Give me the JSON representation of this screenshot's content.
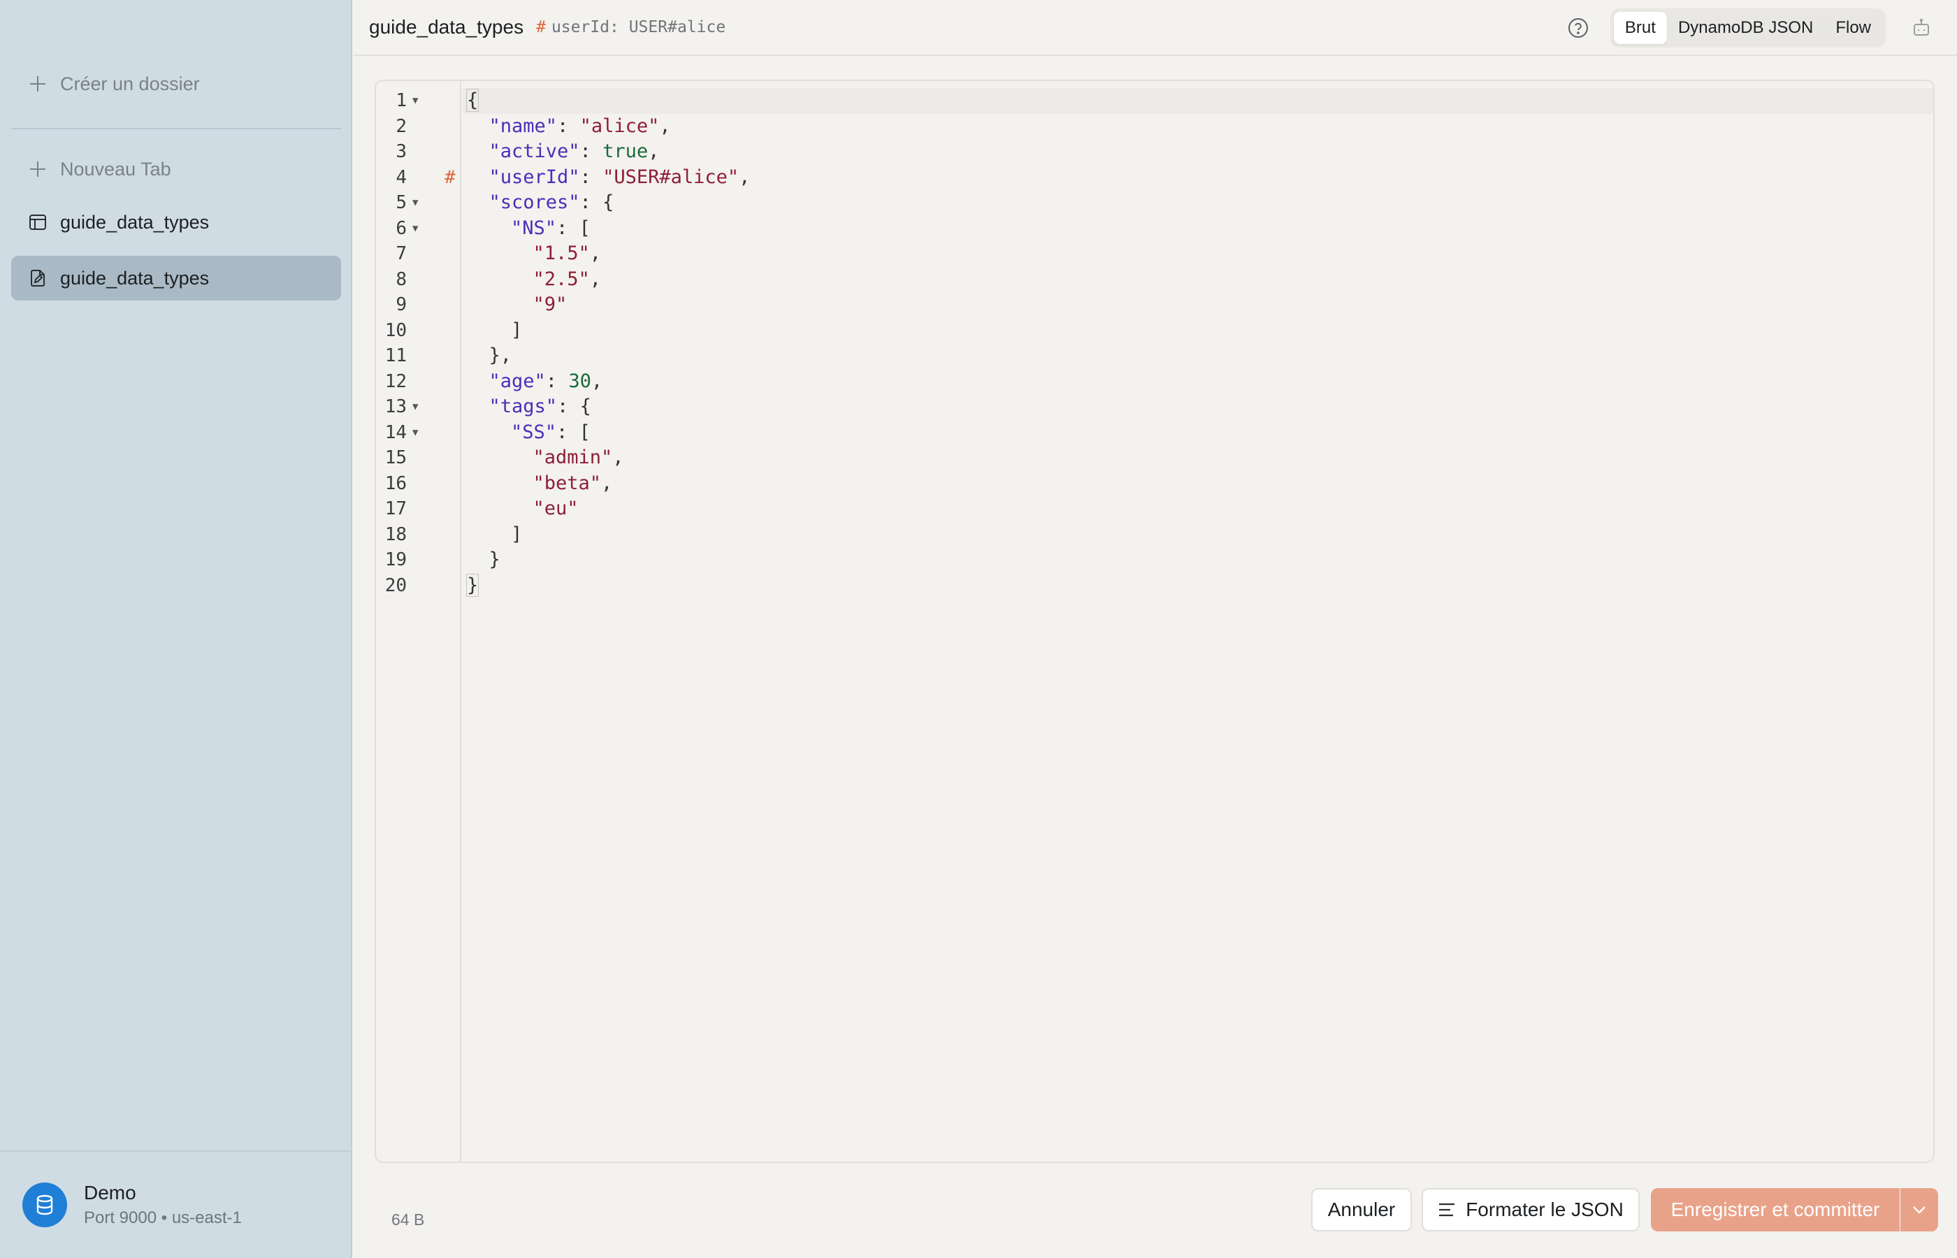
{
  "sidebar": {
    "create_folder": "Créer un dossier",
    "new_tab": "Nouveau Tab",
    "items": [
      {
        "label": "guide_data_types",
        "icon": "table-icon"
      },
      {
        "label": "guide_data_types",
        "icon": "document-edit-icon",
        "active": true
      }
    ],
    "footer": {
      "name": "Demo",
      "meta": "Port 9000 • us-east-1",
      "icon": "database-icon"
    }
  },
  "header": {
    "title": "guide_data_types",
    "hash": "#",
    "pk_label": "userId: USER#alice",
    "view_modes": [
      "Brut",
      "DynamoDB JSON",
      "Flow"
    ],
    "selected_mode": "Brut"
  },
  "editor": {
    "lines": [
      {
        "n": "1",
        "code": "{"
      },
      {
        "n": "2",
        "code": "\"name\": \"alice\","
      },
      {
        "n": "3",
        "code": "\"active\": true,"
      },
      {
        "n": "4",
        "code": "\"userId\": \"USER#alice\","
      },
      {
        "n": "5",
        "code": "\"scores\": {"
      },
      {
        "n": "6",
        "code": "\"NS\": ["
      },
      {
        "n": "7",
        "code": "\"1.5\","
      },
      {
        "n": "8",
        "code": "\"2.5\","
      },
      {
        "n": "9",
        "code": "\"9\""
      },
      {
        "n": "10",
        "code": "]"
      },
      {
        "n": "11",
        "code": "},"
      },
      {
        "n": "12",
        "code": "\"age\": 30,"
      },
      {
        "n": "13",
        "code": "\"tags\": {"
      },
      {
        "n": "14",
        "code": "\"SS\": ["
      },
      {
        "n": "15",
        "code": "\"admin\","
      },
      {
        "n": "16",
        "code": "\"beta\","
      },
      {
        "n": "17",
        "code": "\"eu\""
      },
      {
        "n": "18",
        "code": "]"
      },
      {
        "n": "19",
        "code": "}"
      },
      {
        "n": "20",
        "code": "}"
      }
    ],
    "key_marker": "#"
  },
  "footer": {
    "size": "64 B",
    "cancel": "Annuler",
    "format": "Formater le JSON",
    "save": "Enregistrer et committer"
  },
  "colors": {
    "accent": "#e9a28a",
    "key_marker": "#e0673c",
    "sidebar_bg": "#d0dce4",
    "sidebar_active": "#a9bac6",
    "avatar": "#1f7fd6",
    "json_key": "#4a2fb6",
    "json_string": "#8e1f35",
    "json_literal": "#1c6a3c"
  }
}
